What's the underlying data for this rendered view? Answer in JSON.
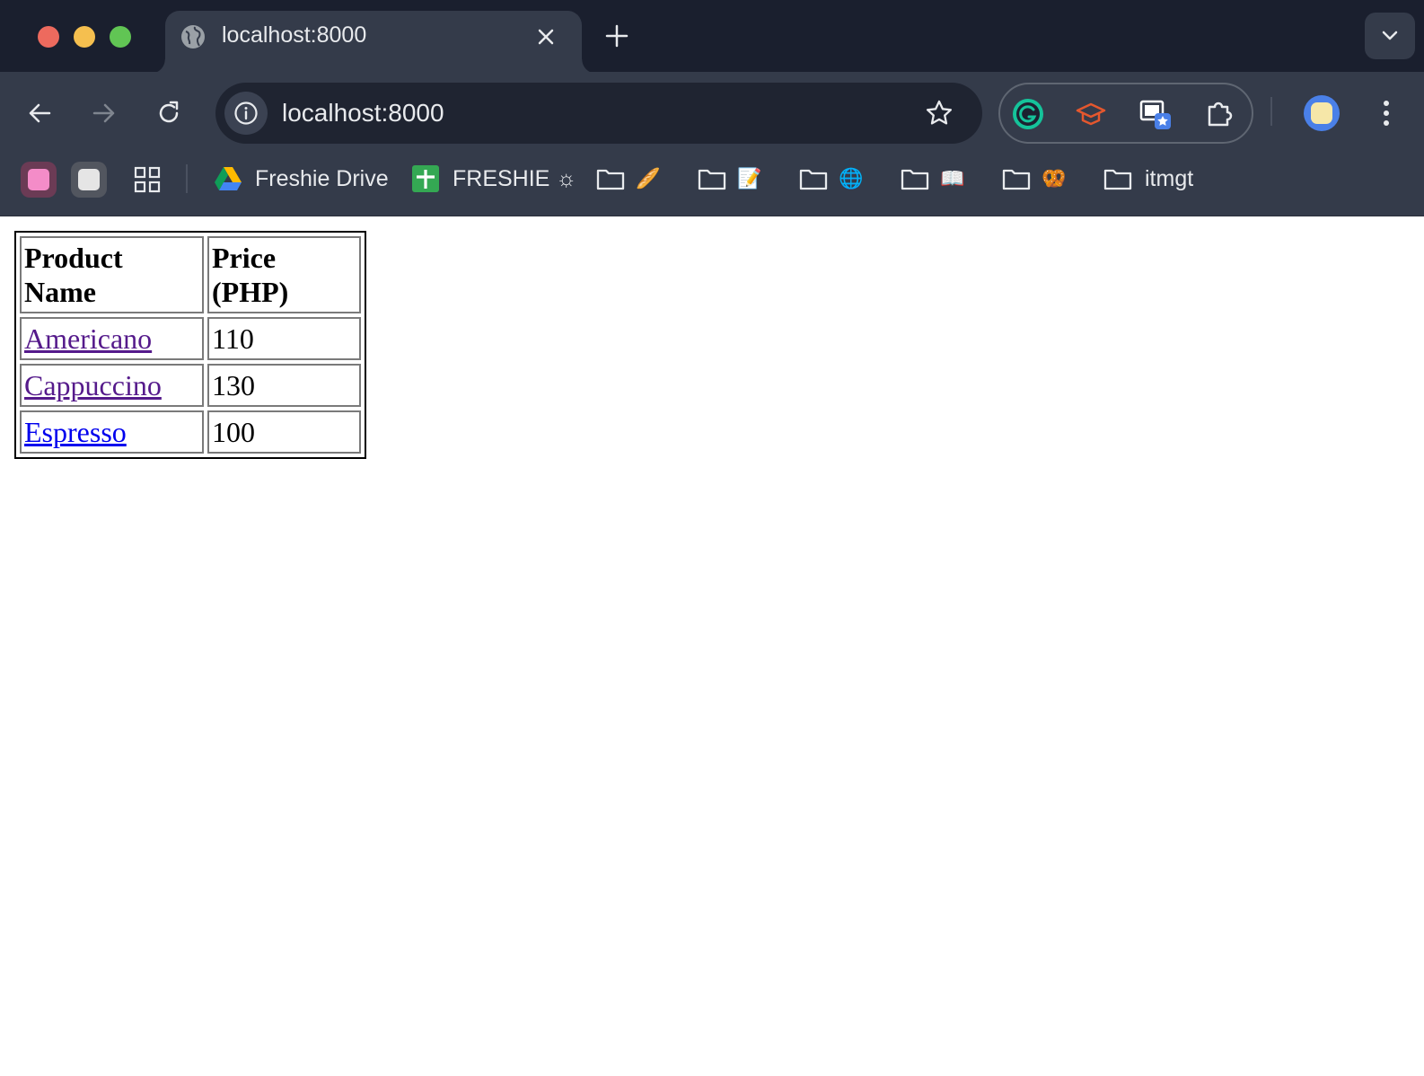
{
  "browser": {
    "tab_title": "localhost:8000",
    "url": "localhost:8000",
    "bookmarks": [
      {
        "label": "Freshie Drive",
        "icon": "google-drive-icon"
      },
      {
        "label": "FRESHIE ☼",
        "icon": "google-sheets-icon"
      },
      {
        "emoji": "🥖",
        "icon": "folder-icon"
      },
      {
        "emoji": "📝",
        "icon": "folder-icon"
      },
      {
        "emoji": "🌐",
        "icon": "folder-icon"
      },
      {
        "emoji": "📖",
        "icon": "folder-icon"
      },
      {
        "emoji": "🥨",
        "icon": "folder-icon"
      },
      {
        "label": "itmgt",
        "icon": "folder-icon"
      }
    ],
    "extensions": [
      "grammarly-icon",
      "graduation-cap-icon",
      "tab-star-icon",
      "puzzle-piece-icon"
    ],
    "colors": {
      "frame": "#1a1f2e",
      "toolbar": "#343b4a",
      "omnibox": "#1f2431",
      "text": "#e8eaed"
    }
  },
  "table": {
    "headers": [
      "Product Name",
      "Price (PHP)"
    ],
    "rows": [
      {
        "name": "Americano",
        "price": "110",
        "visited": true
      },
      {
        "name": "Cappuccino",
        "price": "130",
        "visited": true
      },
      {
        "name": "Espresso",
        "price": "100",
        "visited": false
      }
    ]
  }
}
